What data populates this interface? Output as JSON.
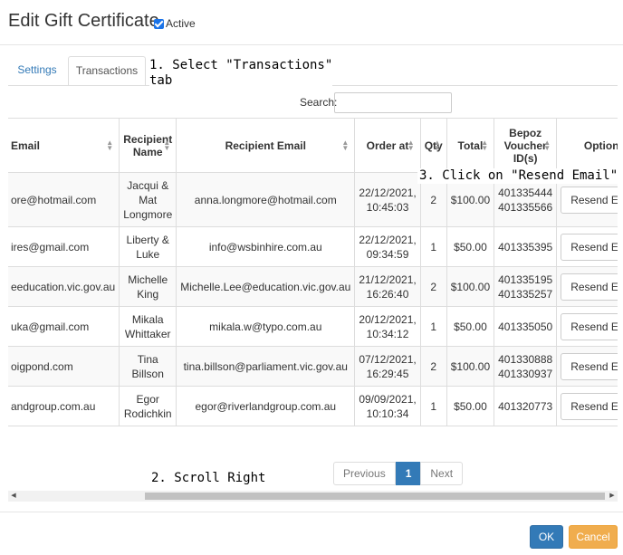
{
  "header": {
    "title": "Edit Gift Certificate",
    "active_label": "Active",
    "active_checked": true
  },
  "tabs": [
    {
      "label": "Settings",
      "selected": false
    },
    {
      "label": "Transactions",
      "selected": true
    }
  ],
  "annotations": {
    "step1": "1. Select \"Transactions\"\ntab",
    "step2": "2. Scroll Right",
    "step3": "3. Click on \"Resend Email\""
  },
  "search": {
    "label": "Search:",
    "value": ""
  },
  "table": {
    "columns": [
      "Email",
      "Recipient Name",
      "Recipient Email",
      "Order at",
      "Qty",
      "Total",
      "Bepoz Voucher ID(s)",
      "Options"
    ],
    "rows": [
      {
        "email": "ore@hotmail.com",
        "recipient_name": "Jacqui & Mat Longmore",
        "recipient_email": "anna.longmore@hotmail.com",
        "order_at": "22/12/2021, 10:45:03",
        "qty": "2",
        "total": "$100.00",
        "voucher_ids": "401335444\n401335566",
        "action": "Resend Email"
      },
      {
        "email": "ires@gmail.com",
        "recipient_name": "Liberty & Luke",
        "recipient_email": "info@wsbinhire.com.au",
        "order_at": "22/12/2021, 09:34:59",
        "qty": "1",
        "total": "$50.00",
        "voucher_ids": "401335395",
        "action": "Resend Email"
      },
      {
        "email": "eeducation.vic.gov.au",
        "recipient_name": "Michelle King",
        "recipient_email": "Michelle.Lee@education.vic.gov.au",
        "order_at": "21/12/2021, 16:26:40",
        "qty": "2",
        "total": "$100.00",
        "voucher_ids": "401335195\n401335257",
        "action": "Resend Email"
      },
      {
        "email": "uka@gmail.com",
        "recipient_name": "Mikala Whittaker",
        "recipient_email": "mikala.w@typo.com.au",
        "order_at": "20/12/2021, 10:34:12",
        "qty": "1",
        "total": "$50.00",
        "voucher_ids": "401335050",
        "action": "Resend Email"
      },
      {
        "email": "oigpond.com",
        "recipient_name": "Tina Billson",
        "recipient_email": "tina.billson@parliament.vic.gov.au",
        "order_at": "07/12/2021, 16:29:45",
        "qty": "2",
        "total": "$100.00",
        "voucher_ids": "401330888\n401330937",
        "action": "Resend Email"
      },
      {
        "email": "andgroup.com.au",
        "recipient_name": "Egor Rodichkin",
        "recipient_email": "egor@riverlandgroup.com.au",
        "order_at": "09/09/2021, 10:10:34",
        "qty": "1",
        "total": "$50.00",
        "voucher_ids": "401320773",
        "action": "Resend Email"
      }
    ]
  },
  "pagination": {
    "previous": "Previous",
    "current": "1",
    "next": "Next"
  },
  "footer": {
    "ok": "OK",
    "cancel": "Cancel"
  }
}
